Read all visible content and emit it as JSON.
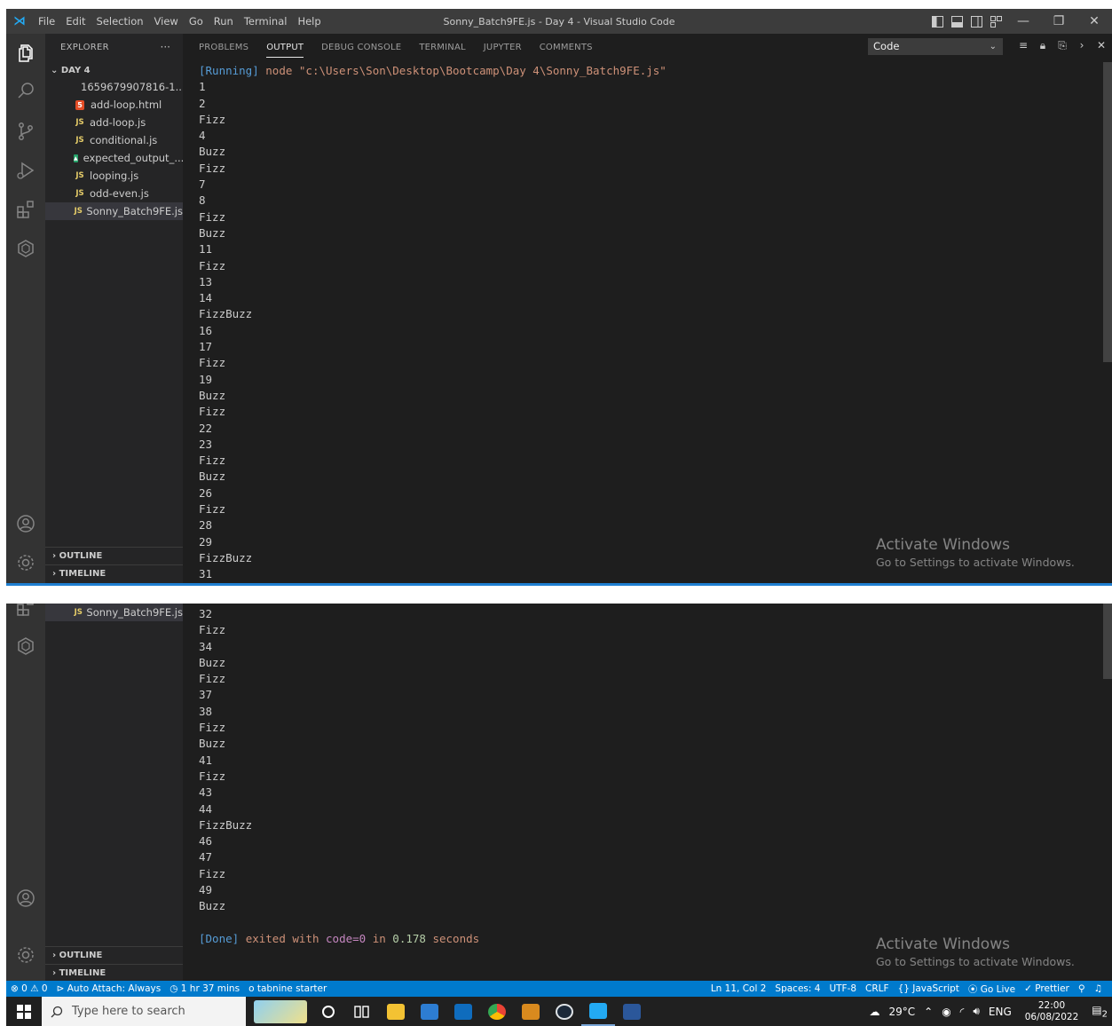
{
  "titlebar": {
    "menu": [
      "File",
      "Edit",
      "Selection",
      "View",
      "Go",
      "Run",
      "Terminal",
      "Help"
    ],
    "title": "Sonny_Batch9FE.js - Day 4 - Visual Studio Code"
  },
  "explorer": {
    "title": "EXPLORER",
    "folder": "DAY 4",
    "files": [
      {
        "name": "1659679907816-1...",
        "icon": "powerpoint-icon"
      },
      {
        "name": "add-loop.html",
        "icon": "html-icon"
      },
      {
        "name": "add-loop.js",
        "icon": "js-icon"
      },
      {
        "name": "conditional.js",
        "icon": "js-icon"
      },
      {
        "name": "expected_output_...",
        "icon": "image-icon"
      },
      {
        "name": "looping.js",
        "icon": "js-icon"
      },
      {
        "name": "odd-even.js",
        "icon": "js-icon"
      },
      {
        "name": "Sonny_Batch9FE.js",
        "icon": "js-icon"
      }
    ],
    "js_badge": "JS",
    "outline": "OUTLINE",
    "timeline": "TIMELINE"
  },
  "panel": {
    "tabs": [
      "PROBLEMS",
      "OUTPUT",
      "DEBUG CONSOLE",
      "TERMINAL",
      "JUPYTER",
      "COMMENTS"
    ],
    "active_tab": "OUTPUT",
    "channel": "Code"
  },
  "output": {
    "running_tag": "[Running]",
    "running_cmd": "node",
    "running_path": "\"c:\\Users\\Son\\Desktop\\Bootcamp\\Day 4\\Sonny_Batch9FE.js\"",
    "lines_top": [
      "1",
      "2",
      "Fizz",
      "4",
      "Buzz",
      "Fizz",
      "7",
      "8",
      "Fizz",
      "Buzz",
      "11",
      "Fizz",
      "13",
      "14",
      "FizzBuzz",
      "16",
      "17",
      "Fizz",
      "19",
      "Buzz",
      "Fizz",
      "22",
      "23",
      "Fizz",
      "Buzz",
      "26",
      "Fizz",
      "28",
      "29",
      "FizzBuzz",
      "31"
    ],
    "lines_bottom": [
      "32",
      "Fizz",
      "34",
      "Buzz",
      "Fizz",
      "37",
      "38",
      "Fizz",
      "Buzz",
      "41",
      "Fizz",
      "43",
      "44",
      "FizzBuzz",
      "46",
      "47",
      "Fizz",
      "49",
      "Buzz"
    ],
    "done_tag": "[Done]",
    "done_text": "exited with",
    "done_code": "code=0",
    "done_in": "in",
    "done_time": "0.178",
    "done_unit": "seconds"
  },
  "watermark": {
    "title": "Activate Windows",
    "subtitle": "Go to Settings to activate Windows."
  },
  "statusbar": {
    "problems": "⊗ 0 ⚠ 0",
    "auto_attach": "Auto Attach: Always",
    "session_time": "1 hr 37 mins",
    "tabnine": "o tabnine starter",
    "position": "Ln 11, Col 2",
    "spaces": "Spaces: 4",
    "encoding": "UTF-8",
    "eol": "CRLF",
    "language": "{} JavaScript",
    "golive": "Go Live",
    "prettier": "✓ Prettier"
  },
  "taskbar": {
    "search_placeholder": "Type here to search",
    "weather": "29°C",
    "lang": "ENG",
    "time": "22:00",
    "date": "06/08/2022",
    "notif_count": "2"
  },
  "colors": {
    "accent": "#007acc",
    "editor_bg": "#1e1e1e",
    "sidebar_bg": "#252526",
    "activity_bg": "#333333"
  }
}
